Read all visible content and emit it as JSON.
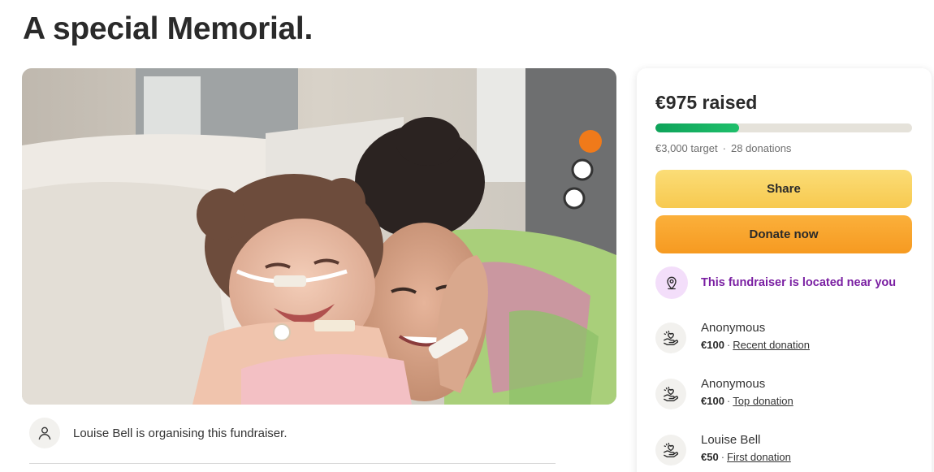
{
  "page": {
    "title": "A special Memorial."
  },
  "organiser": {
    "text": "Louise Bell is organising this fundraiser."
  },
  "summary": {
    "raised": "€975 raised",
    "progress_fraction": 0.325,
    "target": "€3,000 target",
    "separator": "·",
    "donations": "28 donations"
  },
  "actions": {
    "share_label": "Share",
    "donate_label": "Donate now"
  },
  "location": {
    "text": "This fundraiser is located near you"
  },
  "donors": [
    {
      "name": "Anonymous",
      "amount": "€100",
      "tag": "Recent donation"
    },
    {
      "name": "Anonymous",
      "amount": "€100",
      "tag": "Top donation"
    },
    {
      "name": "Louise Bell",
      "amount": "€50",
      "tag": "First donation"
    }
  ],
  "icons": {
    "organiser": "user-icon",
    "location": "map-pin-icon",
    "donor": "heart-hand-icon"
  },
  "colors": {
    "progress": "#1fbf6b",
    "share_button": "#f7c94f",
    "donate_button": "#f69a21",
    "location_text": "#7a1fa2",
    "location_badge": "#f3defa"
  }
}
